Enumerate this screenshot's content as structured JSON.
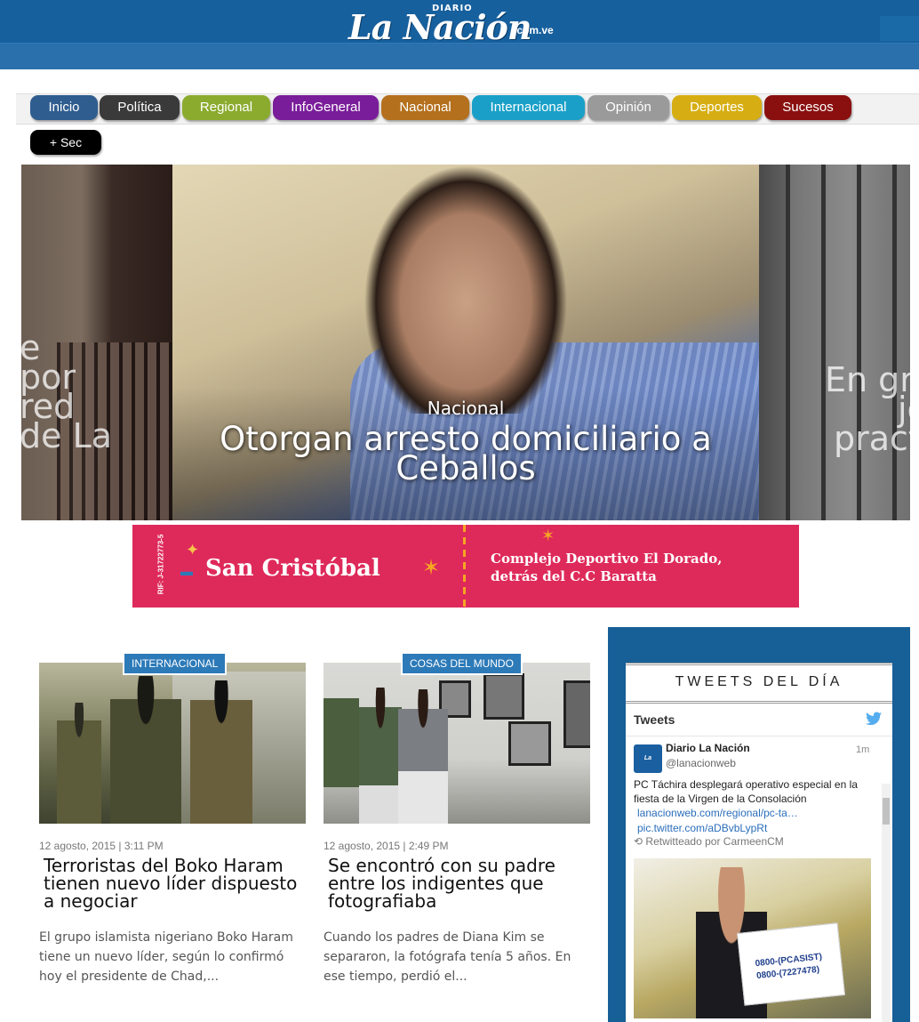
{
  "header": {
    "logo_diario": "DIARIO",
    "logo_name": "La Nación",
    "logo_domain": ".com.ve"
  },
  "nav": {
    "items": [
      {
        "label": "Inicio",
        "color": "#2f5d8f"
      },
      {
        "label": "Política",
        "color": "#3a3a3a"
      },
      {
        "label": "Regional",
        "color": "#8bab2e"
      },
      {
        "label": "InfoGeneral",
        "color": "#7a1d9a"
      },
      {
        "label": "Nacional",
        "color": "#b4701c"
      },
      {
        "label": "Internacional",
        "color": "#1aa0c8"
      },
      {
        "label": "Opinión",
        "color": "#9a9a9a"
      },
      {
        "label": "Deportes",
        "color": "#d6ae13"
      },
      {
        "label": "Sucesos",
        "color": "#8a1010"
      }
    ],
    "more_label": "+ Sec"
  },
  "slider": {
    "left_text": [
      "e",
      "por",
      "red",
      "de La"
    ],
    "main_category": "Nacional",
    "main_title": "Otorgan arresto domiciliario a Ceballos",
    "right_text": [
      "En gra",
      "jov",
      "pract"
    ]
  },
  "banner": {
    "rif": "RIF: J-31722773-5",
    "city": "San Cristóbal",
    "info_line1": "Complejo Deportivo El Dorado,",
    "info_line2": "detrás del C.C Baratta"
  },
  "articles": [
    {
      "tag": "INTERNACIONAL",
      "date": "12 agosto, 2015 | 3:11 PM",
      "headline": "Terroristas del Boko Haram tienen nuevo líder dispuesto a negociar",
      "excerpt": "El grupo islamista nigeriano Boko Haram tiene un nuevo líder, según lo confirmó hoy el presidente de Chad,..."
    },
    {
      "tag": "COSAS DEL MUNDO",
      "date": "12 agosto, 2015 | 2:49 PM",
      "headline": "Se encontró con su padre entre los indigentes que fotografiaba",
      "excerpt": "Cuando los padres de Diana Kim se separaron, la fotógrafa tenía 5 años. En ese tiempo, perdió el..."
    }
  ],
  "sidebar": {
    "title": "TWEETS DEL DÍA",
    "tweets_label": "Tweets",
    "tweet": {
      "avatar_text": "La Nación",
      "user_name": "Diario La Nación",
      "handle": "@lanacionweb",
      "time": "1m",
      "text": "PC Táchira desplegará operativo especial en la fiesta de la Virgen de la Consolación",
      "link1": "lanacionweb.com/regional/pc-ta…",
      "link2": "pic.twitter.com/aDBvbLypRt",
      "retweet": "Retwitteado por CarmeenCM",
      "sign_line1": "0800-(PCASIST)",
      "sign_line2": "0800-(7227478)"
    }
  }
}
